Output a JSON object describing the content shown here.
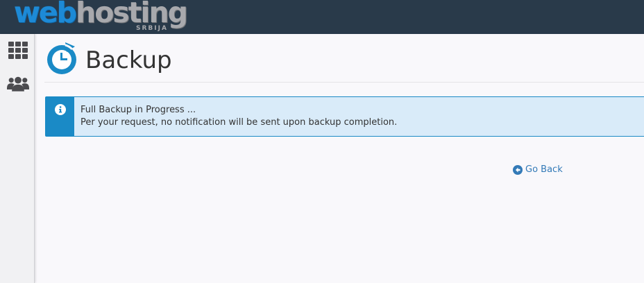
{
  "header": {
    "logo_primary": "web",
    "logo_secondary": "hosting",
    "logo_subtext": "SRBIJA"
  },
  "sidebar": {
    "items": [
      {
        "icon": "grid-icon",
        "label": ""
      },
      {
        "icon": "users-icon",
        "label": ""
      }
    ]
  },
  "page": {
    "title": "Backup",
    "icon": "backup-icon"
  },
  "alert": {
    "type": "info",
    "line1": "Full Backup in Progress ...",
    "line2": "Per your request, no notification will be sent upon backup completion."
  },
  "actions": {
    "go_back_label": "Go Back"
  },
  "colors": {
    "topbar": "#293a4a",
    "accent": "#1a8ac6",
    "alert_bg": "#d9ebf9",
    "link": "#337ab7"
  }
}
